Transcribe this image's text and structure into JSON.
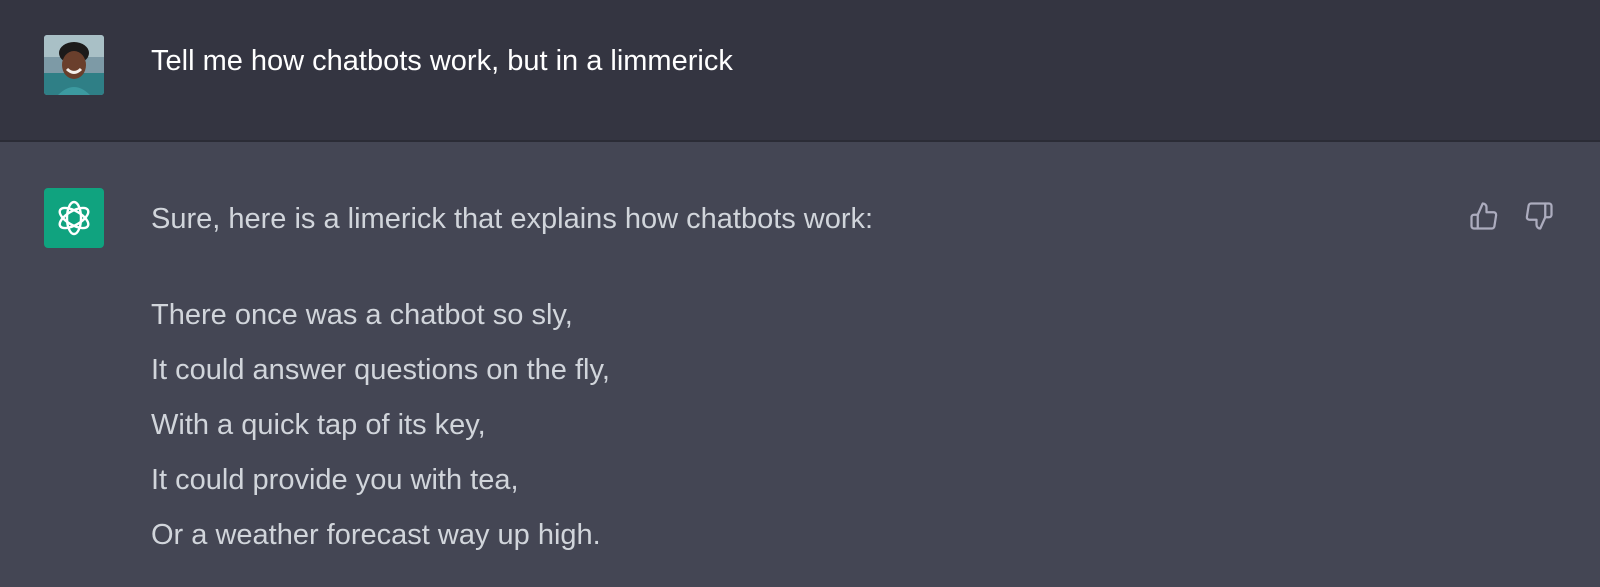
{
  "user_message": {
    "avatar": "user-photo-avatar",
    "text": "Tell me how chatbots work, but in a limmerick"
  },
  "assistant_message": {
    "avatar": "openai-logo-icon",
    "intro": "Sure, here is a limerick that explains how chatbots work:",
    "lines": [
      "There once was a chatbot so sly,",
      "It could answer questions on the fly,",
      "With a quick tap of its key,",
      "It could provide you with tea,",
      "Or a weather forecast way up high."
    ],
    "feedback": {
      "thumbs_up_icon": "thumbs-up-icon",
      "thumbs_down_icon": "thumbs-down-icon"
    }
  },
  "colors": {
    "user_row_bg": "#343541",
    "assistant_row_bg": "#444654",
    "bot_avatar_bg": "#10a37f",
    "text": "#d1d5db"
  }
}
